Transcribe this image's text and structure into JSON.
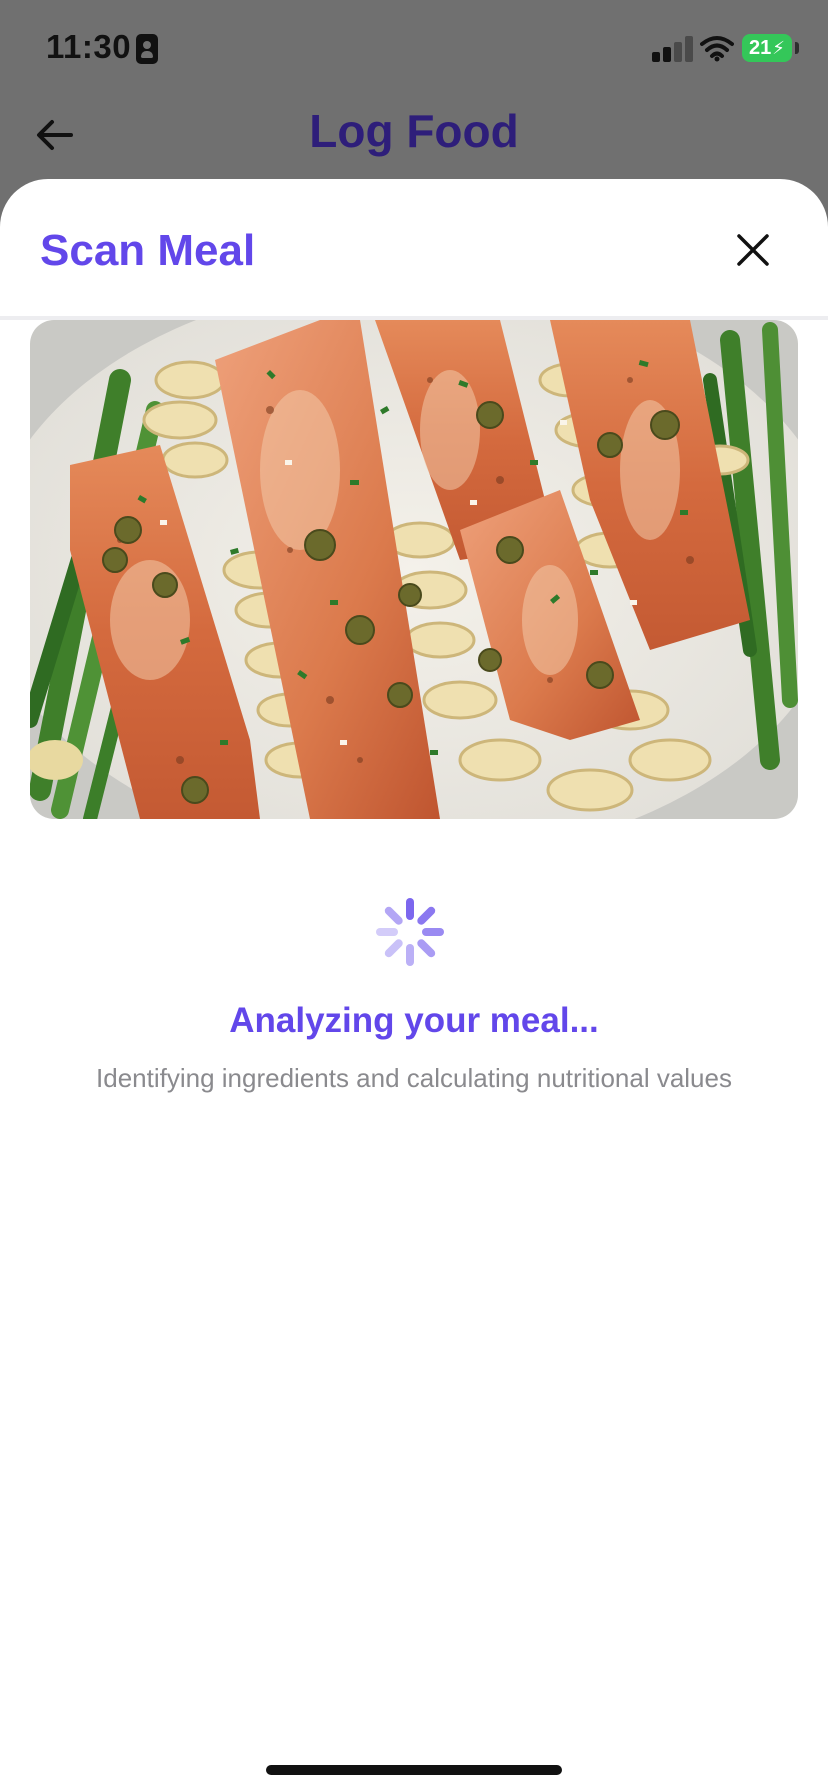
{
  "status_bar": {
    "time": "11:30",
    "battery": "21"
  },
  "header": {
    "title": "Log Food",
    "back_icon": "arrow-left-icon"
  },
  "sheet": {
    "title": "Scan Meal",
    "close_icon": "close-icon",
    "image_subject": "salmon-pasta-photo"
  },
  "analysis": {
    "title": "Analyzing your meal...",
    "subtitle": "Identifying ingredients and calculating nutritional values"
  },
  "colors": {
    "accent": "#6247ea",
    "header_title": "#2e1e7a",
    "spinner": "#a999f3",
    "subtitle": "#8a8a8e",
    "battery": "#34c759"
  }
}
